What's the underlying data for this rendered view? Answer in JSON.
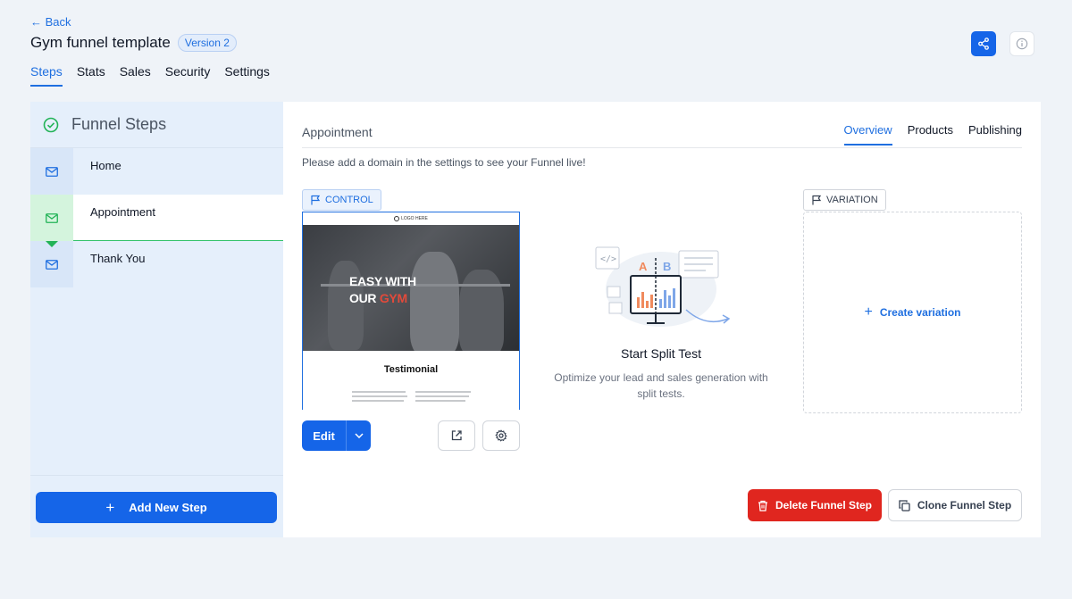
{
  "header": {
    "back_label": "Back",
    "title": "Gym funnel template",
    "version_badge": "Version 2",
    "tabs": [
      {
        "label": "Steps",
        "active": true
      },
      {
        "label": "Stats"
      },
      {
        "label": "Sales"
      },
      {
        "label": "Security"
      },
      {
        "label": "Settings"
      }
    ],
    "share_icon": "share-icon",
    "info_icon": "info-icon"
  },
  "sidebar": {
    "title": "Funnel Steps",
    "steps": [
      {
        "label": "Home",
        "icon": "mail-icon"
      },
      {
        "label": "Appointment",
        "icon": "mail-icon",
        "active": true
      },
      {
        "label": "Thank You",
        "icon": "mail-icon"
      }
    ],
    "add_step_label": "Add New Step"
  },
  "main": {
    "step_name": "Appointment",
    "tabs": [
      {
        "label": "Overview",
        "active": true
      },
      {
        "label": "Products"
      },
      {
        "label": "Publishing"
      }
    ],
    "domain_message": "Please add a domain in the settings to see your Funnel live!",
    "control_label": "CONTROL",
    "variation_label": "VARIATION",
    "preview": {
      "logo_text": "LOGO HERE",
      "hero_line1": "EASY WITH",
      "hero_line2a": "OUR",
      "hero_line2b": "GYM",
      "section_title": "Testimonial"
    },
    "edit_label": "Edit",
    "split_test": {
      "title": "Start Split Test",
      "description": "Optimize your lead and sales generation with split tests.",
      "label_a": "A",
      "label_b": "B"
    },
    "create_variation_label": "Create variation",
    "delete_label": "Delete Funnel Step",
    "clone_label": "Clone Funnel Step"
  },
  "colors": {
    "primary": "#1565e8",
    "danger": "#e0261f",
    "success": "#33c26a",
    "page_bg": "#eff3f8"
  }
}
